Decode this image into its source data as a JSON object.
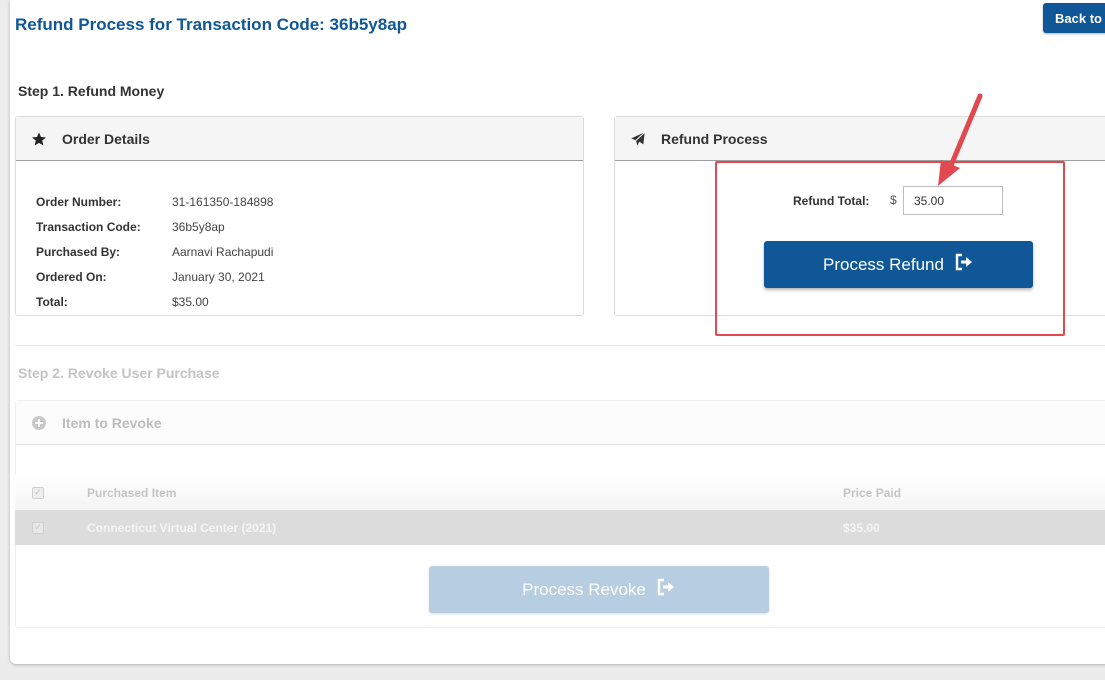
{
  "header": {
    "title": "Refund Process for Transaction Code: 36b5y8ap",
    "back_label": "Back to"
  },
  "step1": {
    "heading": "Step 1. Refund Money",
    "order_details": {
      "title": "Order Details",
      "rows": [
        {
          "label": "Order Number:",
          "value": "31-161350-184898"
        },
        {
          "label": "Transaction Code:",
          "value": "36b5y8ap"
        },
        {
          "label": "Purchased By:",
          "value": "Aarnavi Rachapudi"
        },
        {
          "label": "Ordered On:",
          "value": "January 30, 2021"
        },
        {
          "label": "Total:",
          "value": "$35.00"
        }
      ]
    },
    "refund_process": {
      "title": "Refund Process",
      "total_label": "Refund Total:",
      "currency": "$",
      "total_value": "35.00",
      "button_label": "Process Refund"
    }
  },
  "step2": {
    "heading": "Step 2. Revoke User Purchase",
    "panel_title": "Item to Revoke",
    "columns": [
      "Purchased Item",
      "Price Paid"
    ],
    "rows": [
      {
        "item": "Connecticut Virtual Center (2021)",
        "price": "$35.00"
      }
    ],
    "button_label": "Process Revoke"
  },
  "colors": {
    "brand": "#0f5797",
    "annotation": "#e2484f"
  }
}
